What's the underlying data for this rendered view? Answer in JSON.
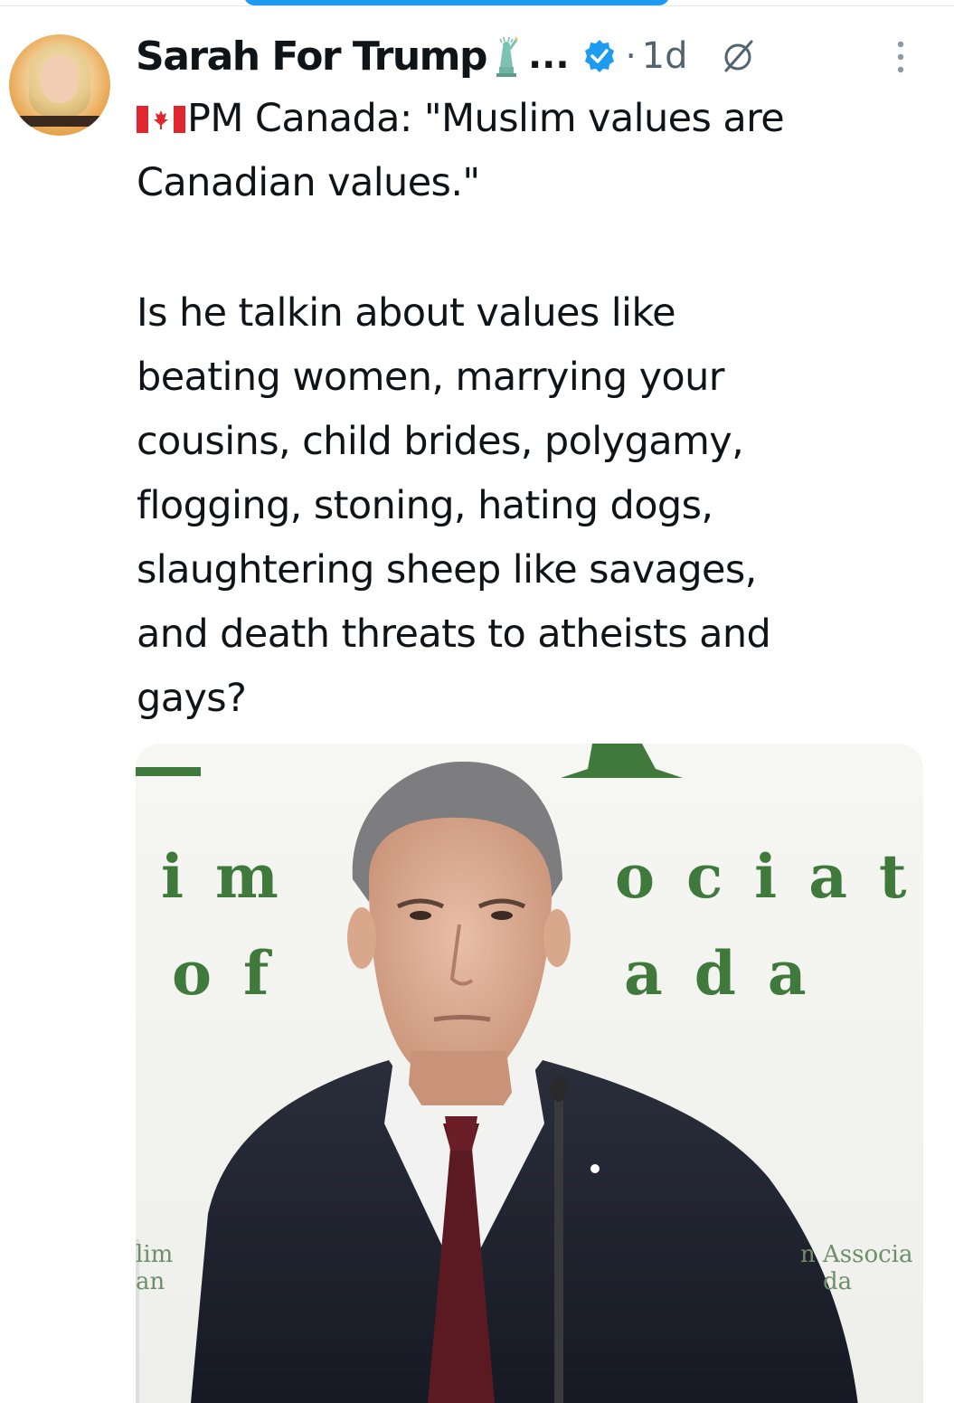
{
  "tweet": {
    "author": {
      "display_name": "Sarah For Trump",
      "name_emoji": "statue-of-liberty-emoji",
      "truncation": "...",
      "verified": true,
      "avatar": "profile-photo"
    },
    "separator": "·",
    "time": "1d",
    "text_lines": [
      "PM Canada: \"Muslim values are",
      "Canadian values.\"",
      "",
      "Is he talkin about values like",
      "beating women, marrying your",
      "cousins, child brides, polygamy,",
      "flogging, stoning, hating dogs,",
      "slaughtering sheep like savages,",
      "and death threats to atheists and",
      "gays?"
    ],
    "flag_emoji": "canada-flag-emoji",
    "media": {
      "kind": "video-thumbnail",
      "backdrop_text": {
        "row1_left": "i m",
        "row1_right": "o c i a t",
        "row2_left": "o f",
        "row2_right": "a d a",
        "lectern_left_1": "lim",
        "lectern_left_2": "an",
        "lectern_right_1": "n Associa",
        "lectern_right_2": "da"
      }
    }
  },
  "icons": {
    "verified": "verified-badge-icon",
    "grok": "grok-icon",
    "more": "more-vertical-icon"
  },
  "colors": {
    "accent_blue": "#1d9bf0",
    "text_primary": "#0f1419",
    "text_secondary": "#536471",
    "backdrop_green": "#3f7a3c"
  }
}
